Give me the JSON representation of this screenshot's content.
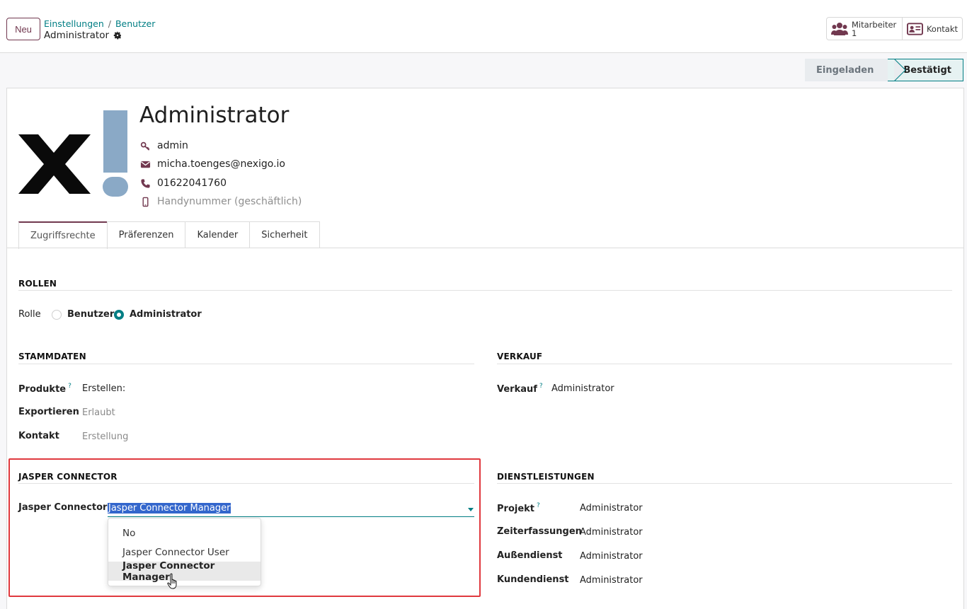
{
  "control_panel": {
    "new_button": "Neu",
    "breadcrumb": [
      "Einstellungen",
      "Benutzer"
    ],
    "breadcrumb_sep": "/",
    "record_title": "Administrator"
  },
  "smart_buttons": {
    "employees_label": "Mitarbeiter",
    "employees_count": "1",
    "contact_label": "Kontakt"
  },
  "statusbar": {
    "stages": [
      "Eingeladen",
      "Bestätigt"
    ],
    "current": "Bestätigt"
  },
  "user": {
    "name": "Administrator",
    "login": "admin",
    "email": "micha.toenges@nexigo.io",
    "phone": "01622041760",
    "mobile_placeholder": "Handynummer (geschäftlich)"
  },
  "tabs": [
    "Zugriffsrechte",
    "Präferenzen",
    "Kalender",
    "Sicherheit"
  ],
  "roles": {
    "title": "ROLLEN",
    "label": "Rolle",
    "options": [
      "Benutzer",
      "Administrator"
    ],
    "selected": "Administrator"
  },
  "stammdaten": {
    "title": "STAMMDATEN",
    "fields": [
      {
        "label": "Produkte",
        "value": "Erstellen:"
      },
      {
        "label": "Exportieren",
        "value": "Erlaubt"
      },
      {
        "label": "Kontakt",
        "value": "Erstellung"
      }
    ]
  },
  "verkauf": {
    "title": "VERKAUF",
    "label": "Verkauf",
    "value": "Administrator"
  },
  "jasper": {
    "title": "JASPER CONNECTOR",
    "label": "Jasper Connector",
    "value": "Jasper Connector Manager",
    "options": [
      "No",
      "Jasper Connector User",
      "Jasper Connector Manager"
    ]
  },
  "dienstleistungen": {
    "title": "DIENSTLEISTUNGEN",
    "fields": [
      {
        "label": "Projekt",
        "value": "Administrator"
      },
      {
        "label": "Zeiterfassungen",
        "value": "Administrator"
      },
      {
        "label": "Außendienst",
        "value": "Administrator"
      },
      {
        "label": "Kundendienst",
        "value": "Administrator"
      }
    ]
  },
  "help_mark": "?",
  "colors": {
    "accent": "#71384f",
    "teal": "#017e84",
    "highlight": "#e0393e",
    "selection": "#3366cc"
  }
}
